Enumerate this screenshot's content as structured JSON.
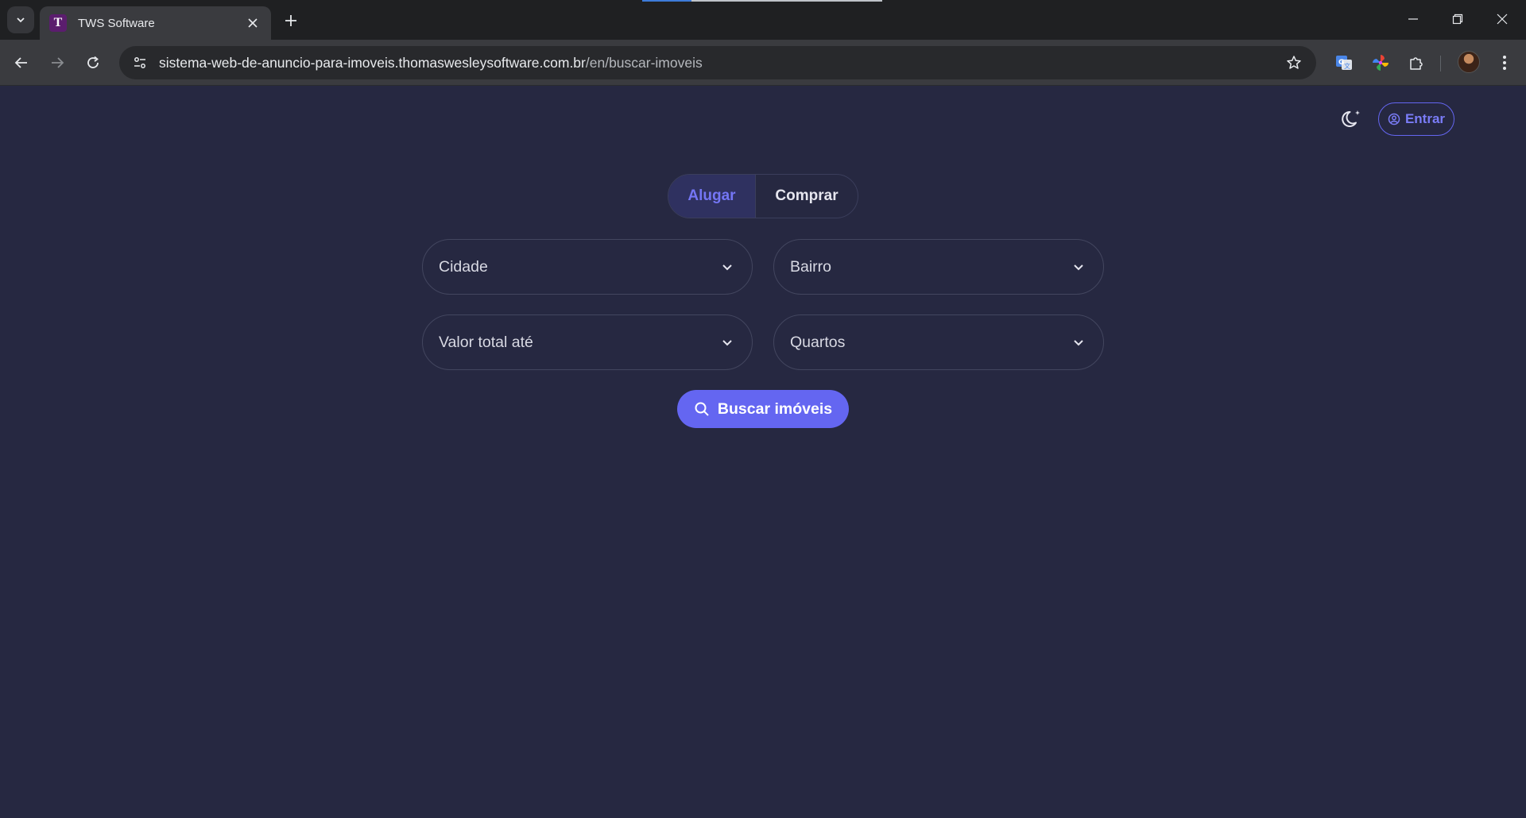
{
  "browser": {
    "tab": {
      "title": "TWS Software",
      "favicon_letter": "T"
    },
    "url": {
      "host": "sistema-web-de-anuncio-para-imoveis.thomaswesleysoftware.com.br",
      "path": "/en/buscar-imoveis"
    }
  },
  "header": {
    "login_label": "Entrar"
  },
  "tabs": {
    "rent_label": "Alugar",
    "buy_label": "Comprar",
    "active": "rent"
  },
  "filters": {
    "city": "Cidade",
    "neighborhood": "Bairro",
    "max_total": "Valor total até",
    "bedrooms": "Quartos"
  },
  "search_button": {
    "label": "Buscar imóveis"
  },
  "colors": {
    "background": "#262841",
    "accent": "#6466f1",
    "chrome": "#3a3b3f"
  }
}
